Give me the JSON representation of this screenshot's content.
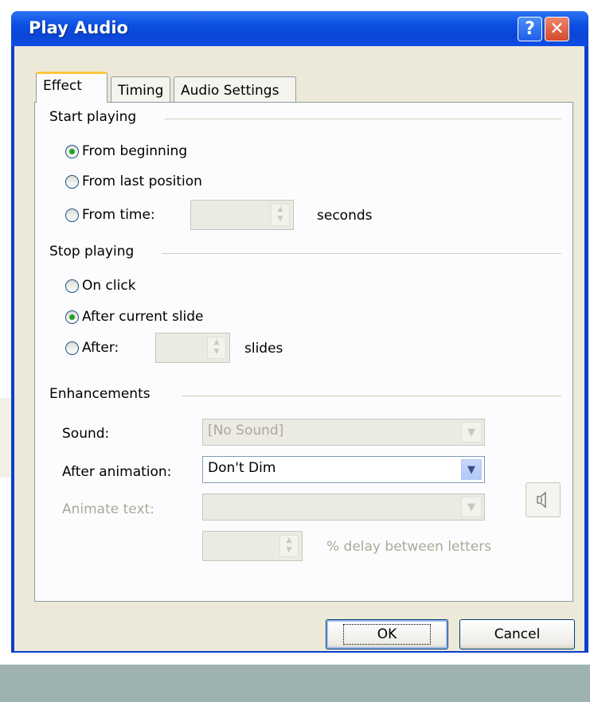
{
  "window": {
    "title": "Play Audio",
    "help_glyph": "?",
    "close_glyph": "✕"
  },
  "tabs": [
    {
      "label": "Effect",
      "active": true
    },
    {
      "label": "Timing",
      "active": false
    },
    {
      "label": "Audio Settings",
      "active": false
    }
  ],
  "start_playing": {
    "heading": "Start playing",
    "from_beginning": "From beginning",
    "from_last_position": "From last position",
    "from_time": "From time:",
    "seconds_label": "seconds",
    "selected": "from_beginning"
  },
  "stop_playing": {
    "heading": "Stop playing",
    "on_click": "On click",
    "after_current_slide": "After current slide",
    "after": "After:",
    "slides_label": "slides",
    "selected": "after_current_slide"
  },
  "enhancements": {
    "heading": "Enhancements",
    "sound_label": "Sound:",
    "sound_value": "[No Sound]",
    "after_animation_label": "After animation:",
    "after_animation_value": "Don't Dim",
    "animate_text_label": "Animate text:",
    "animate_text_value": "",
    "delay_label": "% delay between letters"
  },
  "buttons": {
    "ok": "OK",
    "cancel": "Cancel"
  },
  "icons": {
    "help": "help-icon",
    "close": "close-icon",
    "speaker": "speaker-icon"
  },
  "colors": {
    "titlebar": "#0a45d6",
    "dialog_bg": "#ece9d8",
    "radio_selected": "#21a121"
  }
}
